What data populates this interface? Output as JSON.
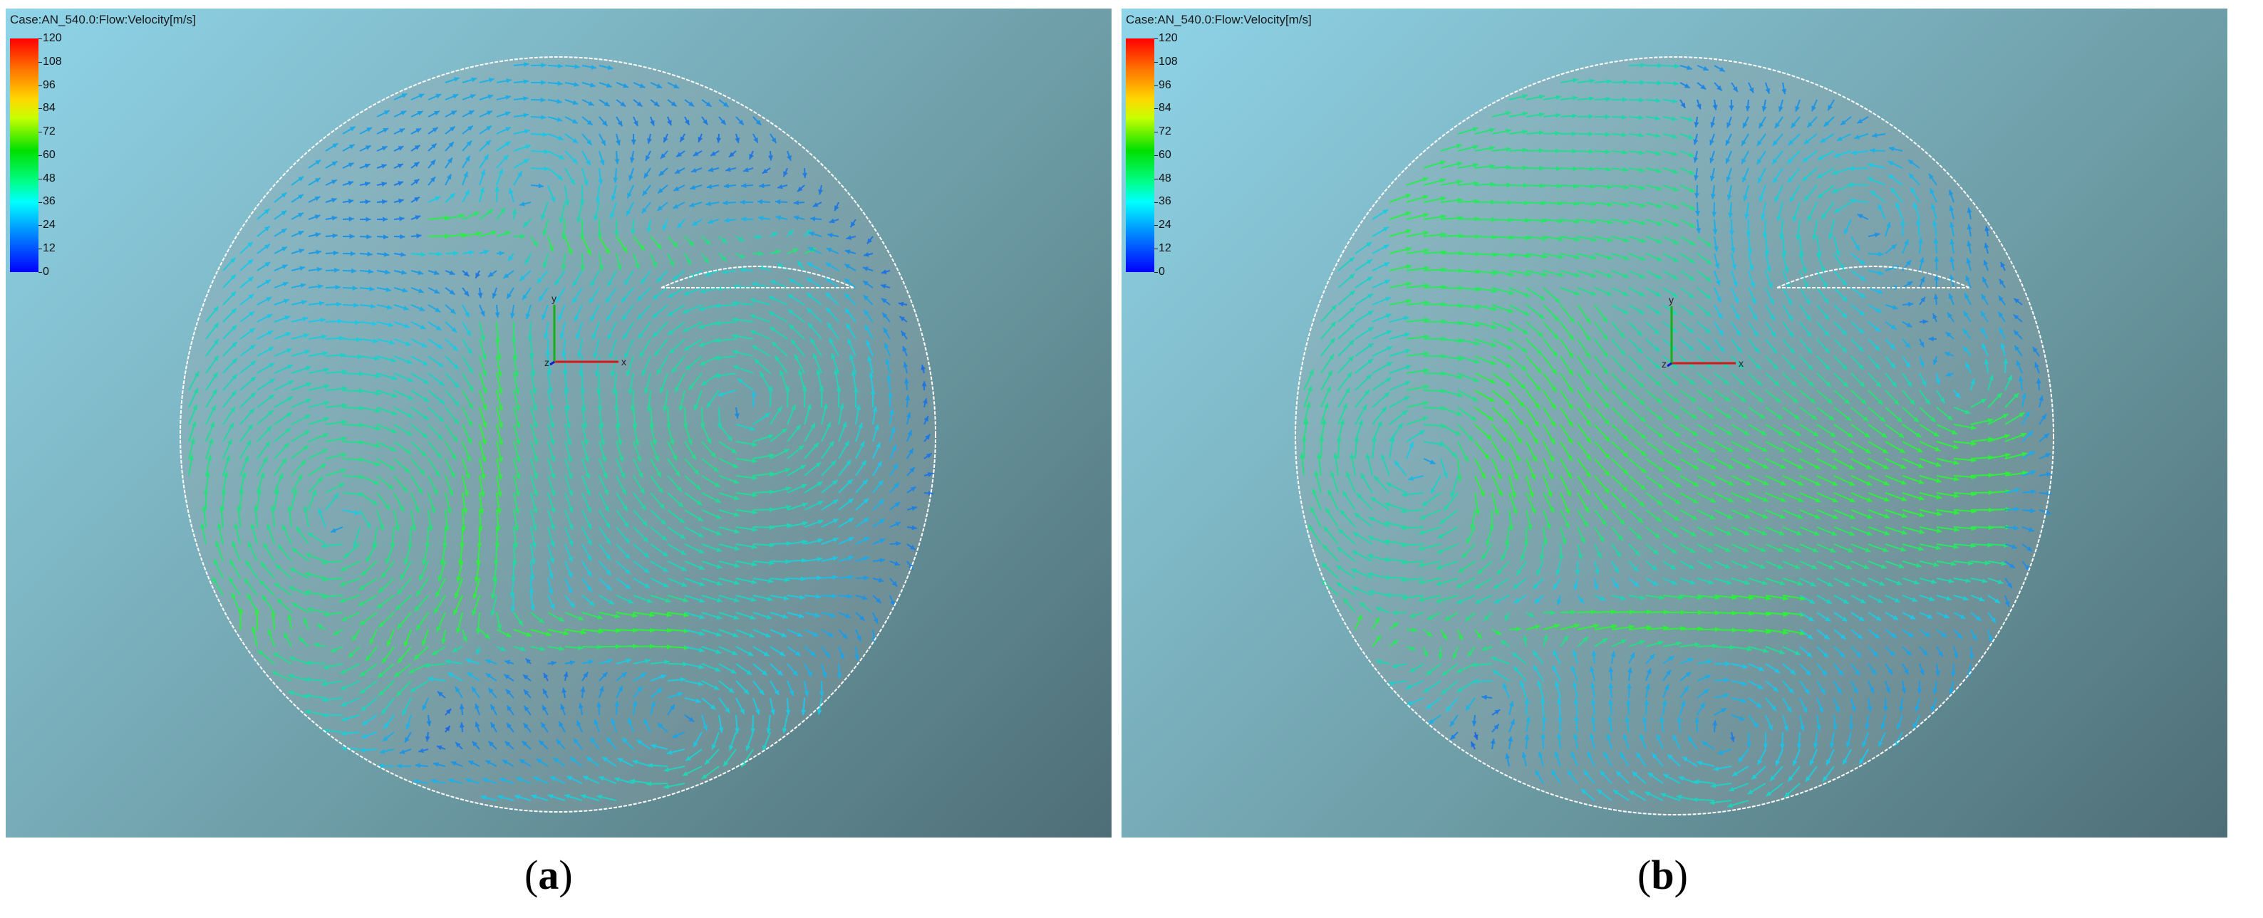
{
  "panels": [
    {
      "case_title": "Case:AN_540.0:Flow:Velocity[m/s]",
      "colorbar_ticks": [
        "120",
        "108",
        "96",
        "84",
        "72",
        "60",
        "48",
        "36",
        "24",
        "12",
        "0"
      ],
      "axis_labels": {
        "x": "x",
        "y": "y",
        "z": "z"
      },
      "caption_letter": "a"
    },
    {
      "case_title": "Case:AN_540.0:Flow:Velocity[m/s]",
      "colorbar_ticks": [
        "120",
        "108",
        "96",
        "84",
        "72",
        "60",
        "48",
        "36",
        "24",
        "12",
        "0"
      ],
      "axis_labels": {
        "x": "x",
        "y": "y",
        "z": "z"
      },
      "caption_letter": "b"
    }
  ],
  "colors": {
    "vector_slow": "#1f5fe0",
    "vector_mid": "#1ec8e6",
    "vector_fast": "#28e07a",
    "vector_jet": "#2ef03a",
    "circle_outline": "#ffffff",
    "axis_x": "#d01818",
    "axis_y": "#18b018",
    "axis_z": "#1818d0"
  }
}
